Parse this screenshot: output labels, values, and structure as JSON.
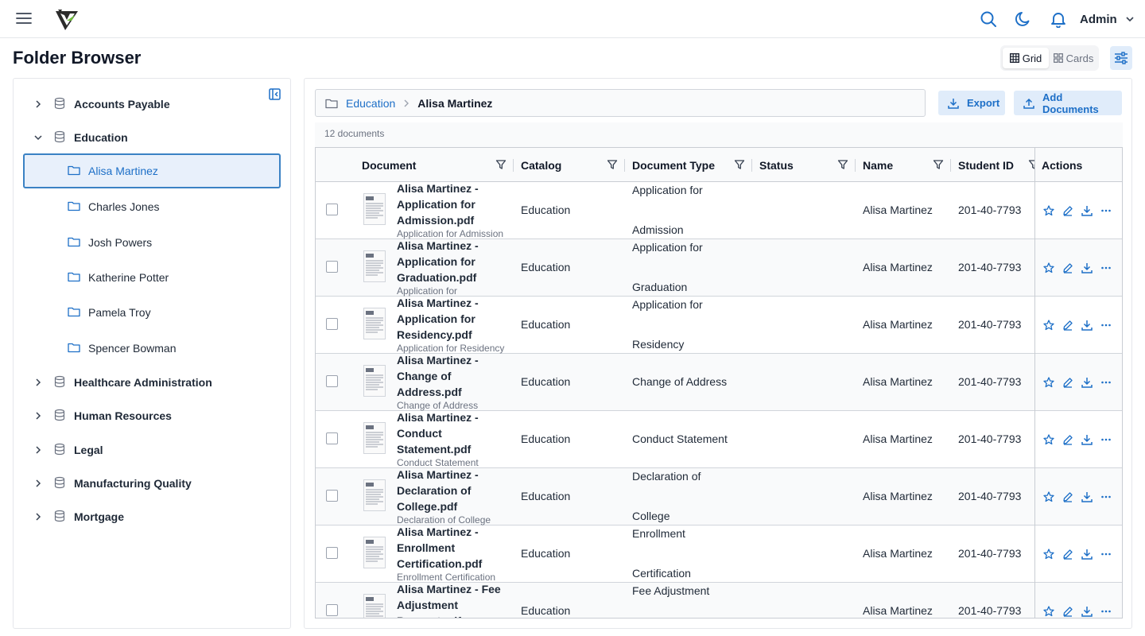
{
  "header": {
    "user_label": "Admin",
    "accent_color": "#1d6fc7",
    "icons": [
      "menu-icon",
      "logo-mark",
      "search-icon",
      "moon-icon",
      "bell-icon",
      "chevron-down-icon"
    ]
  },
  "page": {
    "title": "Folder Browser"
  },
  "view_toggle": {
    "grid_label": "Grid",
    "cards_label": "Cards",
    "active": "Grid"
  },
  "tree": {
    "top_items": [
      {
        "label": "Accounts Payable",
        "expanded": false
      },
      {
        "label": "Education",
        "expanded": true
      },
      {
        "label": "Healthcare Administration",
        "expanded": false
      },
      {
        "label": "Human Resources",
        "expanded": false
      },
      {
        "label": "Legal",
        "expanded": false
      },
      {
        "label": "Manufacturing Quality",
        "expanded": false
      },
      {
        "label": "Mortgage",
        "expanded": false
      }
    ],
    "children": [
      {
        "label": "Alisa Martinez",
        "selected": true
      },
      {
        "label": "Charles Jones",
        "selected": false
      },
      {
        "label": "Josh Powers",
        "selected": false
      },
      {
        "label": "Katherine Potter",
        "selected": false
      },
      {
        "label": "Pamela Troy",
        "selected": false
      },
      {
        "label": "Spencer Bowman",
        "selected": false
      }
    ]
  },
  "breadcrumb": {
    "parent": "Education",
    "current": "Alisa Martinez"
  },
  "buttons": {
    "export_label": "Export",
    "add_label": "Add Documents"
  },
  "doc_count": "12 documents",
  "columns": {
    "document": "Document",
    "catalog": "Catalog",
    "document_type": "Document Type",
    "status": "Status",
    "name": "Name",
    "student_id": "Student ID",
    "actions": "Actions"
  },
  "rows": [
    {
      "title_lines": "Alisa Martinez -\nApplication for\nAdmission.pdf",
      "subtitle": "Application for Admission",
      "catalog": "Education",
      "type_line1": "Application for",
      "type_line2": "Admission",
      "status": "",
      "name": "Alisa Martinez",
      "student_id": "201-40-7793"
    },
    {
      "title_lines": "Alisa Martinez -\nApplication for\nGraduation.pdf",
      "subtitle": "Application for",
      "catalog": "Education",
      "type_line1": "Application for",
      "type_line2": "Graduation",
      "status": "",
      "name": "Alisa Martinez",
      "student_id": "201-40-7793"
    },
    {
      "title_lines": "Alisa Martinez -\nApplication for\nResidency.pdf",
      "subtitle": "Application for Residency",
      "catalog": "Education",
      "type_line1": "Application for",
      "type_line2": "Residency",
      "status": "",
      "name": "Alisa Martinez",
      "student_id": "201-40-7793"
    },
    {
      "title_lines": "Alisa Martinez -\nChange of\nAddress.pdf",
      "subtitle": "Change of Address",
      "catalog": "Education",
      "type_line1": "Change of Address",
      "type_line2": "",
      "status": "",
      "name": "Alisa Martinez",
      "student_id": "201-40-7793"
    },
    {
      "title_lines": "Alisa Martinez -\nConduct\nStatement.pdf",
      "subtitle": "Conduct Statement",
      "catalog": "Education",
      "type_line1": "Conduct Statement",
      "type_line2": "",
      "status": "",
      "name": "Alisa Martinez",
      "student_id": "201-40-7793"
    },
    {
      "title_lines": "Alisa Martinez -\nDeclaration of\nCollege.pdf",
      "subtitle": "Declaration of College",
      "catalog": "Education",
      "type_line1": "Declaration of",
      "type_line2": "College",
      "status": "",
      "name": "Alisa Martinez",
      "student_id": "201-40-7793"
    },
    {
      "title_lines": "Alisa Martinez -\nEnrollment\nCertification.pdf",
      "subtitle": "Enrollment Certification",
      "catalog": "Education",
      "type_line1": "Enrollment",
      "type_line2": "Certification",
      "status": "",
      "name": "Alisa Martinez",
      "student_id": "201-40-7793"
    },
    {
      "title_lines": "Alisa Martinez - Fee\nAdjustment\nRequest.pdf",
      "subtitle": "",
      "catalog": "Education",
      "type_line1": "Fee Adjustment",
      "type_line2": "",
      "status": "",
      "name": "Alisa Martinez",
      "student_id": "201-40-7793"
    }
  ],
  "row_actions": [
    "star-icon",
    "edit-icon",
    "download-icon",
    "more-icon"
  ]
}
